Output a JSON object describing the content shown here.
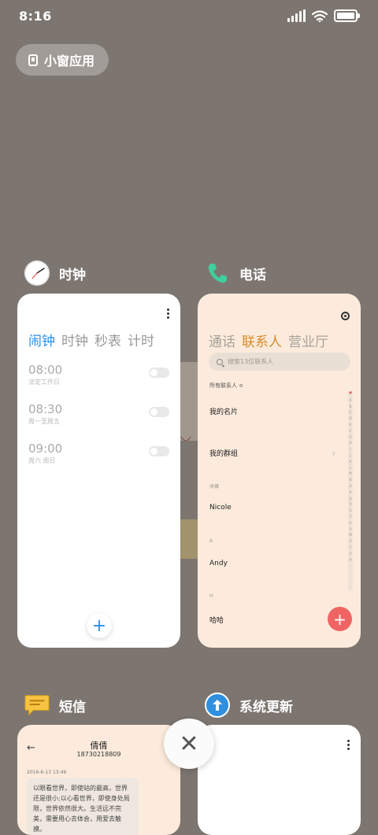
{
  "status_bar": {
    "time": "8:16"
  },
  "small_window": {
    "label": "小窗应用"
  },
  "apps": {
    "clock": {
      "name": "时钟",
      "tabs": [
        "闹钟",
        "时钟",
        "秒表",
        "计时"
      ],
      "alarms": [
        {
          "time": "08:00",
          "repeat": "法定工作日"
        },
        {
          "time": "08:30",
          "repeat": "周一至周五"
        },
        {
          "time": "09:00",
          "repeat": "周六 周日"
        }
      ],
      "add_label": "+"
    },
    "phone": {
      "name": "电话",
      "tabs": [
        "通话",
        "联系人",
        "营业厅"
      ],
      "search_placeholder": "搜索13位联系人",
      "filter": "所有联系人 ≎",
      "my_card": "我的名片",
      "my_groups": "我的群组",
      "section_favorites": "收藏",
      "contact1": "Nicole",
      "section_a": "A",
      "contact2": "Andy",
      "section_h": "H",
      "contact3": "哈哈",
      "index_letters": [
        "A",
        "B",
        "C",
        "D",
        "E",
        "F",
        "G",
        "H",
        "I",
        "J",
        "K",
        "L",
        "M",
        "N",
        "O",
        "P",
        "Q",
        "R",
        "S",
        "T",
        "U",
        "V",
        "W",
        "X",
        "Y",
        "Z",
        "#"
      ],
      "add_label": "+"
    },
    "sms": {
      "name": "短信",
      "contact_name": "倩倩",
      "contact_number": "18730218809",
      "date": "2016-6-13 13:49",
      "message": "以眼看世界，即使站的最高，世界还是很小;以心看世界，即使身处局限，世界依然很大。生活远不完美，需要用心去体会，用爱去触摸。"
    },
    "update": {
      "name": "系统更新"
    }
  },
  "close_label": "✕",
  "colors": {
    "background": "#7d7670",
    "clock_accent": "#2b8fe6",
    "phone_accent": "#d48a2a",
    "phone_fab": "#f06564"
  }
}
